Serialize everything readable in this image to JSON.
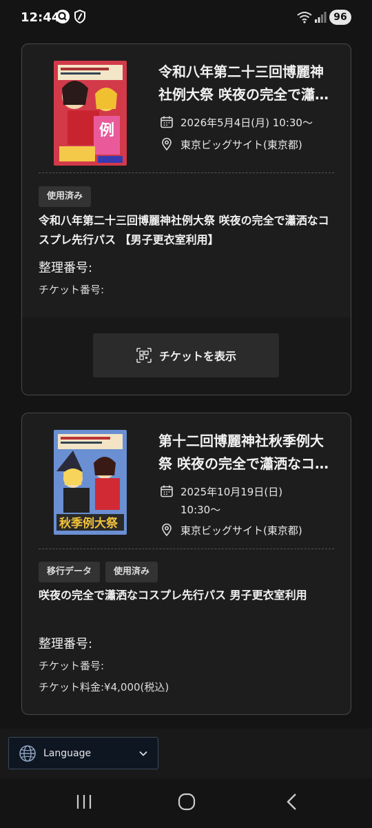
{
  "status_bar": {
    "time": "12:44",
    "battery": "96"
  },
  "events": [
    {
      "title": "令和八年第二十三回博麗神社例大祭 咲夜の完全で瀟洒なコスプレ先行パス",
      "date_text": "2026年5月4日(月) 10:30〜",
      "venue": "東京ビッグサイト(東京都)",
      "tags": [
        "使用済み"
      ],
      "ticket_name": "令和八年第二十三回博麗神社例大祭 咲夜の完全で瀟洒なコスプレ先行パス 【男子更衣室利用】",
      "seiri_label": "整理番号:",
      "ticket_no_label": "チケット番号:",
      "show_button_label": "チケットを表示"
    },
    {
      "title": "第十二回博麗神社秋季例大祭 咲夜の完全で瀟洒なコスプレ先行パス",
      "date_text": "2025年10月19日(日) 10:30〜",
      "venue": "東京ビッグサイト(東京都)",
      "tags": [
        "移行データ",
        "使用済み"
      ],
      "ticket_name": "咲夜の完全で瀟洒なコスプレ先行パス 男子更衣室利用",
      "seiri_label": "整理番号:",
      "ticket_no_label": "チケット番号:",
      "price_text": "チケット料金:¥4,000(税込)"
    }
  ],
  "language": {
    "label": "Language"
  },
  "icons": {
    "calendar": "calendar-icon",
    "location": "location-pin-icon",
    "qr": "qr-scan-icon",
    "globe": "globe-icon",
    "chevron": "chevron-down-icon"
  },
  "colors": {
    "background": "#141414",
    "card": "#1d1d1d",
    "tag": "#333333",
    "button": "#2b2b2b",
    "language_select": "#0e1622"
  }
}
